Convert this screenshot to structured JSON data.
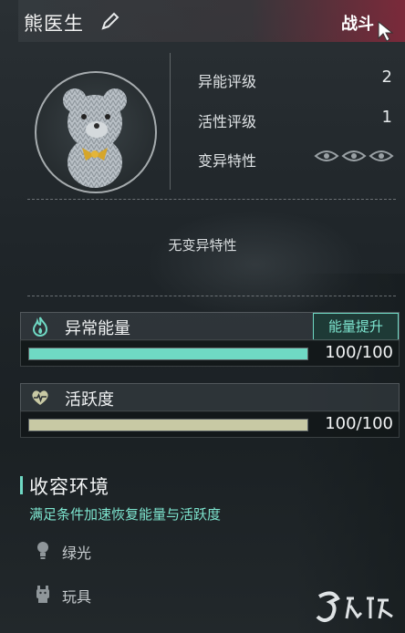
{
  "header": {
    "name": "熊医生",
    "battle_label": "战斗"
  },
  "stats": [
    {
      "label": "异能评级",
      "value": "2"
    },
    {
      "label": "活性评级",
      "value": "1"
    },
    {
      "label": "变异特性",
      "value": ""
    }
  ],
  "trait_text": "无变异特性",
  "energy": {
    "title": "异常能量",
    "boost_label": "能量提升",
    "value_text": "100/100",
    "fill_fraction": 1.0,
    "color": "#6fd9c4"
  },
  "activity": {
    "title": "活跃度",
    "value_text": "100/100",
    "fill_fraction": 1.0,
    "color": "#c8c9a4"
  },
  "containment": {
    "title": "收容环境",
    "subtitle": "满足条件加速恢复能量与活跃度",
    "conditions": [
      {
        "label": "绿光",
        "icon": "lightbulb-icon"
      },
      {
        "label": "玩具",
        "icon": "toy-icon"
      }
    ]
  },
  "colors": {
    "accent": "#6fd9c4",
    "battle": "#b0283f"
  }
}
